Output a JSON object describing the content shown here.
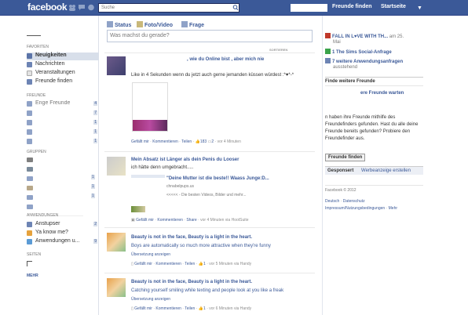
{
  "topbar": {
    "logo": "facebook",
    "search_placeholder": "Suche",
    "find_friends": "Freunde finden",
    "home": "Startseite",
    "account_caret": "▼"
  },
  "left": {
    "favorites_head": "Favoriten",
    "favorites": [
      {
        "label": "Neuigkeiten",
        "icon": "news-feed-icon",
        "active": true
      },
      {
        "label": "Nachrichten",
        "icon": "messages-icon"
      },
      {
        "label": "Veranstaltungen",
        "icon": "events-icon"
      },
      {
        "label": "Freunde finden",
        "icon": "friends-icon"
      }
    ],
    "friends_head": "Freunde",
    "friends": [
      {
        "label": "Enge Freunde",
        "count": "4"
      },
      {
        "label": "",
        "count": "7"
      },
      {
        "label": "",
        "count": "1"
      },
      {
        "label": "",
        "count": "1"
      },
      {
        "label": "",
        "count": "1"
      }
    ],
    "groups_head": "Gruppen",
    "groups_counts": [
      "1",
      "1",
      "1"
    ],
    "apps_head": "Anwendungen",
    "apps": [
      {
        "label": "Anstupser",
        "count": "2"
      },
      {
        "label": "Ya know me?",
        "count": ""
      },
      {
        "label": "Anwendungen u...",
        "count": "9"
      }
    ],
    "pages_head": "Seiten",
    "more": "Mehr"
  },
  "composer": {
    "tab_status": "Status",
    "tab_photo": "Foto/Video",
    "tab_question": "Frage",
    "placeholder": "Was machst du gerade?",
    "sort": "SORTIEREN"
  },
  "stories": [
    {
      "title": ", wie du Online bist , aber mich nie",
      "text": "Like in 4 Sekunden wenn du jetzt auch gerne jemanden küssen würdest :*♥*-*",
      "like": "Gefällt mir",
      "comment": "Kommentieren",
      "share": "Teilen",
      "likes": "183",
      "comments": "2",
      "time": "vor 4 Minuten"
    },
    {
      "title": "Mein Absatz ist Länger als dein Penis du Looser",
      "text": "ich hätte denn umgebracht.....",
      "link_title": "\"Deine Mutter ist die beste!! Waass Junge:D...",
      "link_domain": "chnabelpups.us",
      "link_desc": "<<<<< - Die besten Videos, Bilder und mehr...",
      "like": "Gefällt mir",
      "comment": "Kommentieren",
      "share": "Share",
      "time": "vor 4 Minuten via HootSuite"
    },
    {
      "title": "Beauty is not in the face, Beauty is a light in the heart.",
      "text": "Boys are automatically so much more attractive when they're funny",
      "translate": "Übersetzung anzeigen",
      "like": "Gefällt mir",
      "comment": "Kommentieren",
      "share": "Teilen",
      "likes": "1",
      "time": "vor 5 Minuten via Handy"
    },
    {
      "title": "Beauty is not in the face, Beauty is a light in the heart.",
      "text": "Catching yourself smiling while texting and people look at you like a freak",
      "translate": "Übersetzung anzeigen",
      "like": "Gefällt mir",
      "comment": "Kommentieren",
      "share": "Teilen",
      "likes": "1",
      "time": "vor 6 Minuten via Handy"
    }
  ],
  "right": {
    "ticker": [
      {
        "text": "FALL IN L♥VE WITH TH...",
        "suffix": " am 25.",
        "line2": "Mai"
      },
      {
        "text": "1 The Sims Social-Anfrage",
        "suffix": ""
      },
      {
        "text": "7 weitere Anwendungsanfragen",
        "suffix": "",
        "line2": "ausstehend"
      }
    ],
    "find_head": "Finde weitere Freunde",
    "find_sub": "ere Freunde warten",
    "find_text": "n haben ihre Freunde mithilfe des Freundefinders gefunden. Hast du alle deine Freunde bereits gefunden? Probiere den Freundefinder aus.",
    "find_button": "Freunde finden",
    "sponsored": "Gesponsert",
    "create_ad": "Werbeanzeige erstellen",
    "copyright": "Facebook © 2012",
    "footer_links": [
      "Deutsch",
      "Datenschutz",
      "Impressum/Nutzungsbedingungen",
      "Mehr"
    ]
  },
  "colors": {
    "brand": "#3b5998",
    "link": "#3b5998"
  }
}
